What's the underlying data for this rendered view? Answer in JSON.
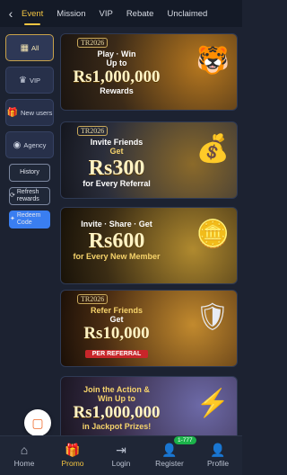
{
  "tabs": {
    "back_icon": "chevron-left-icon",
    "items": [
      "Event",
      "Mission",
      "VIP",
      "Rebate",
      "Unclaimed"
    ],
    "active": "Event"
  },
  "sidebar": {
    "items": [
      {
        "label": "All",
        "icon": "grid-icon"
      },
      {
        "label": "VIP",
        "icon": "crown-icon"
      },
      {
        "label": "New users",
        "icon": "gift-icon"
      },
      {
        "label": "Agency",
        "icon": "agency-icon"
      }
    ],
    "history_label": "History",
    "refresh_label": "Refresh rewards",
    "redeem_label": "Redeem Code"
  },
  "banners": [
    {
      "badge": "TR2026",
      "line1": "Play · Win",
      "line2": "Up to",
      "amount": "Rs1,000,000",
      "line3": "Rewards"
    },
    {
      "badge": "TR2026",
      "line1": "Invite Friends",
      "line2": "Get",
      "amount": "Rs300",
      "line3": "for Every Referral"
    },
    {
      "badge": "",
      "line1": "Invite · Share · Get",
      "amount": "Rs600",
      "line3": "for Every New Member"
    },
    {
      "badge": "TR2026",
      "line1": "Refer Friends",
      "line2": "Get",
      "amount": "Rs10,000",
      "line3": "PER REFERRAL"
    },
    {
      "badge": "",
      "line1": "Join the Action &",
      "line2": "Win Up to",
      "amount": "Rs1,000,000",
      "line3": "in Jackpot Prizes!"
    }
  ],
  "bottom_nav": {
    "items": [
      {
        "label": "Home",
        "icon": "home-icon"
      },
      {
        "label": "Promo",
        "icon": "gift-icon"
      },
      {
        "label": "Login",
        "icon": "login-icon"
      },
      {
        "label": "Register",
        "icon": "register-icon"
      },
      {
        "label": "Profile",
        "icon": "profile-icon"
      }
    ],
    "active": "Promo",
    "register_badge": "1-777"
  }
}
